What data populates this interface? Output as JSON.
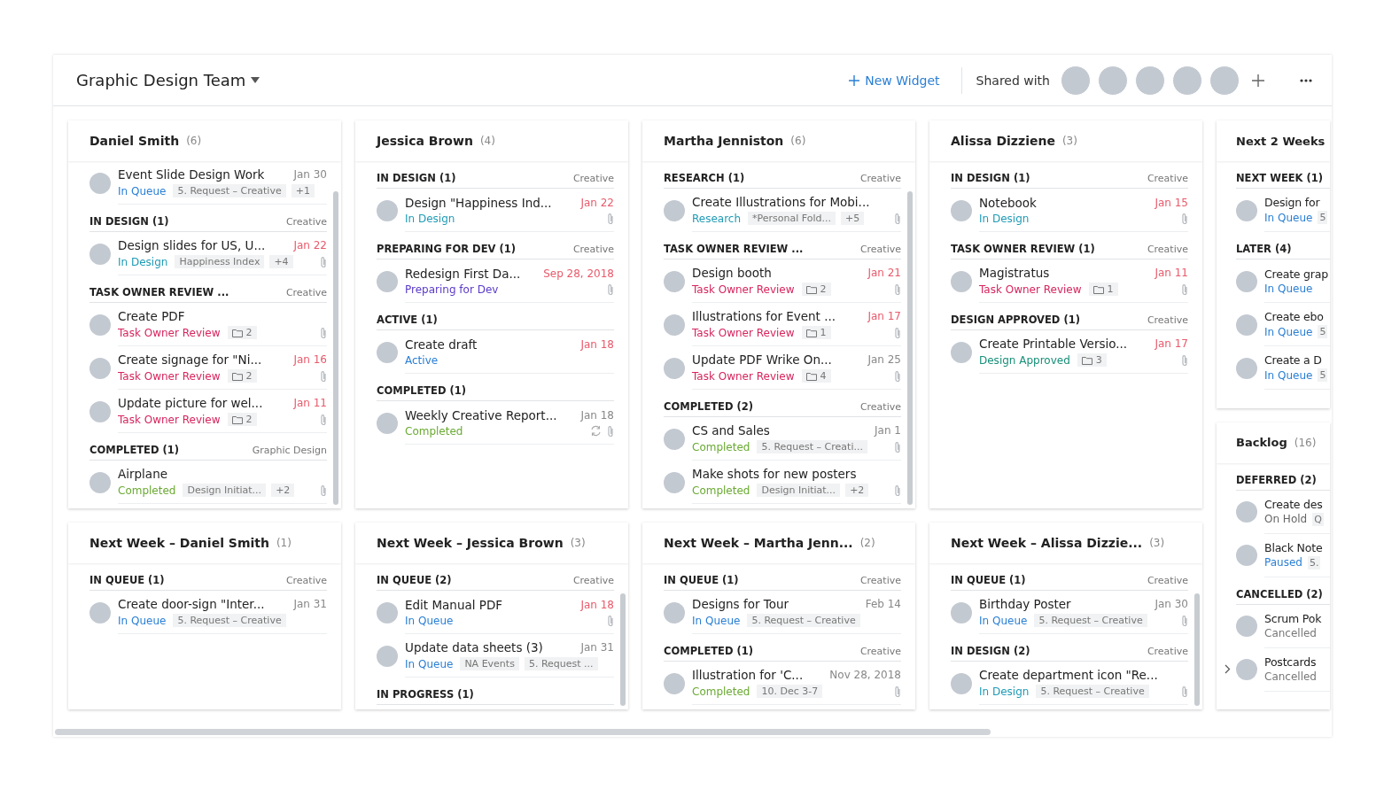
{
  "header": {
    "title": "Graphic Design Team",
    "new_widget": "New Widget",
    "shared_label": "Shared with"
  },
  "columns": [
    {
      "widgets": [
        {
          "title": "Daniel Smith",
          "count": "(6)",
          "scrollbar": true,
          "groups": [
            {
              "tasks": [
                {
                  "title": "Event Slide Design Work",
                  "date": "Jan 30",
                  "overdue": false,
                  "status": "In Queue",
                  "color": "#2a7fd4",
                  "tags": [
                    {
                      "kind": "label",
                      "text": "5. Request – Creative"
                    },
                    {
                      "kind": "label",
                      "text": "+1"
                    }
                  ],
                  "attachment": false
                }
              ]
            },
            {
              "name": "IN DESIGN (1)",
              "category": "Creative",
              "tasks": [
                {
                  "title": "Design slides for US, U...",
                  "date": "Jan 22",
                  "overdue": true,
                  "status": "In Design",
                  "color": "#1f9bb5",
                  "tags": [
                    {
                      "kind": "label",
                      "text": "Happiness Index"
                    },
                    {
                      "kind": "label",
                      "text": "+4"
                    }
                  ],
                  "attachment": true
                }
              ]
            },
            {
              "name": "TASK OWNER REVIEW ...",
              "category": "Creative",
              "tasks": [
                {
                  "title": "Create PDF",
                  "status": "Task Owner Review",
                  "color": "#d6245d",
                  "tags": [
                    {
                      "kind": "folder",
                      "text": "2"
                    }
                  ],
                  "attachment": true
                },
                {
                  "title": "Create signage for \"Ni...",
                  "date": "Jan 16",
                  "overdue": true,
                  "status": "Task Owner Review",
                  "color": "#d6245d",
                  "tags": [
                    {
                      "kind": "folder",
                      "text": "2"
                    }
                  ],
                  "attachment": true
                },
                {
                  "title": "Update picture for wel...",
                  "date": "Jan 11",
                  "overdue": true,
                  "status": "Task Owner Review",
                  "color": "#d6245d",
                  "tags": [
                    {
                      "kind": "folder",
                      "text": "2"
                    }
                  ],
                  "attachment": true
                }
              ]
            },
            {
              "name": "COMPLETED (1)",
              "category": "Graphic Design",
              "tasks": [
                {
                  "title": "Airplane",
                  "status": "Completed",
                  "color": "#6aaa32",
                  "tags": [
                    {
                      "kind": "label",
                      "text": "Design Initiat..."
                    },
                    {
                      "kind": "label",
                      "text": "+2"
                    }
                  ],
                  "attachment": true
                }
              ]
            }
          ]
        },
        {
          "title": "Next Week – Daniel Smith",
          "count": "(1)",
          "scrollbar": false,
          "groups": [
            {
              "name": "IN QUEUE (1)",
              "category": "Creative",
              "tasks": [
                {
                  "title": "Create door-sign \"Inter...",
                  "date": "Jan 31",
                  "overdue": false,
                  "status": "In Queue",
                  "color": "#2a7fd4",
                  "tags": [
                    {
                      "kind": "label",
                      "text": "5. Request – Creative"
                    }
                  ],
                  "attachment": false
                }
              ]
            }
          ]
        }
      ]
    },
    {
      "widgets": [
        {
          "title": "Jessica Brown",
          "count": "(4)",
          "scrollbar": false,
          "groups": [
            {
              "name": "IN DESIGN (1)",
              "category": "Creative",
              "tasks": [
                {
                  "title": "Design \"Happiness Ind...",
                  "date": "Jan 22",
                  "overdue": true,
                  "status": "In Design",
                  "color": "#1f9bb5",
                  "attachment": true
                }
              ]
            },
            {
              "name": "PREPARING FOR DEV (1)",
              "category": "Creative",
              "tasks": [
                {
                  "title": "Redesign First Da...",
                  "date": "Sep 28, 2018",
                  "overdue": true,
                  "status": "Preparing for Dev",
                  "color": "#5a3ac8",
                  "attachment": true
                }
              ]
            },
            {
              "name": "ACTIVE (1)",
              "tasks": [
                {
                  "title": "Create draft",
                  "date": "Jan 18",
                  "overdue": true,
                  "status": "Active",
                  "color": "#2a7fd4",
                  "attachment": false
                }
              ]
            },
            {
              "name": "COMPLETED (1)",
              "tasks": [
                {
                  "title": "Weekly Creative Report...",
                  "date": "Jan 18",
                  "overdue": false,
                  "status": "Completed",
                  "color": "#6aaa32",
                  "attachment": true,
                  "recurring": true
                }
              ]
            }
          ]
        },
        {
          "title": "Next Week – Jessica Brown",
          "count": "(3)",
          "scrollbar": true,
          "groups": [
            {
              "name": "IN QUEUE (2)",
              "category": "Creative",
              "tasks": [
                {
                  "title": "Edit Manual PDF",
                  "date": "Jan 18",
                  "overdue": true,
                  "status": "In Queue",
                  "color": "#2a7fd4",
                  "attachment": true
                },
                {
                  "title": "Update data sheets (3)",
                  "date": "Jan 31",
                  "overdue": false,
                  "status": "In Queue",
                  "color": "#2a7fd4",
                  "tags": [
                    {
                      "kind": "label",
                      "text": "NA Events"
                    },
                    {
                      "kind": "label",
                      "text": "5. Request ..."
                    }
                  ],
                  "attachment": false
                }
              ]
            },
            {
              "name": "IN PROGRESS (1)"
            }
          ]
        }
      ]
    },
    {
      "widgets": [
        {
          "title": "Martha Jenniston",
          "count": "(6)",
          "scrollbar": true,
          "groups": [
            {
              "name": "RESEARCH (1)",
              "category": "Creative",
              "tasks": [
                {
                  "title": "Create Illustrations for Mobi...",
                  "status": "Research",
                  "color": "#1f9bb5",
                  "tags": [
                    {
                      "kind": "label",
                      "text": "*Personal Fold..."
                    },
                    {
                      "kind": "label",
                      "text": "+5"
                    }
                  ],
                  "attachment": true
                }
              ]
            },
            {
              "name": "TASK OWNER REVIEW ...",
              "category": "Creative",
              "tasks": [
                {
                  "title": "Design booth",
                  "date": "Jan 21",
                  "overdue": true,
                  "status": "Task Owner Review",
                  "color": "#d6245d",
                  "tags": [
                    {
                      "kind": "folder",
                      "text": "2"
                    }
                  ],
                  "attachment": true
                },
                {
                  "title": "Illustrations for Event ...",
                  "date": "Jan 17",
                  "overdue": true,
                  "status": "Task Owner Review",
                  "color": "#d6245d",
                  "tags": [
                    {
                      "kind": "folder",
                      "text": "1"
                    }
                  ],
                  "attachment": true
                },
                {
                  "title": "Update PDF Wrike On...",
                  "date": "Jan 25",
                  "overdue": false,
                  "status": "Task Owner Review",
                  "color": "#d6245d",
                  "tags": [
                    {
                      "kind": "folder",
                      "text": "4"
                    }
                  ],
                  "attachment": true
                }
              ]
            },
            {
              "name": "COMPLETED (2)",
              "category": "Creative",
              "tasks": [
                {
                  "title": "CS and Sales",
                  "date": "Jan 1",
                  "overdue": false,
                  "status": "Completed",
                  "color": "#6aaa32",
                  "tags": [
                    {
                      "kind": "label",
                      "text": "5. Request – Creati..."
                    }
                  ],
                  "attachment": true
                },
                {
                  "title": "Make shots for new posters",
                  "status": "Completed",
                  "color": "#6aaa32",
                  "tags": [
                    {
                      "kind": "label",
                      "text": "Design Initiat..."
                    },
                    {
                      "kind": "label",
                      "text": "+2"
                    }
                  ],
                  "attachment": true
                }
              ]
            }
          ]
        },
        {
          "title": "Next Week – Martha Jenn...",
          "count": "(2)",
          "scrollbar": false,
          "groups": [
            {
              "name": "IN QUEUE (1)",
              "category": "Creative",
              "tasks": [
                {
                  "title": "Designs for Tour",
                  "date": "Feb 14",
                  "overdue": false,
                  "status": "In Queue",
                  "color": "#2a7fd4",
                  "tags": [
                    {
                      "kind": "label",
                      "text": "5. Request – Creative"
                    }
                  ],
                  "attachment": false
                }
              ]
            },
            {
              "name": "COMPLETED (1)",
              "category": "Creative",
              "tasks": [
                {
                  "title": "Illustration for 'C...",
                  "date": "Nov 28, 2018",
                  "overdue": false,
                  "status": "Completed",
                  "color": "#6aaa32",
                  "tags": [
                    {
                      "kind": "label",
                      "text": "10. Dec 3-7"
                    }
                  ],
                  "attachment": true
                }
              ]
            }
          ]
        }
      ]
    },
    {
      "widgets": [
        {
          "title": "Alissa Dizziene",
          "count": "(3)",
          "scrollbar": false,
          "groups": [
            {
              "name": "IN DESIGN (1)",
              "category": "Creative",
              "tasks": [
                {
                  "title": "Notebook",
                  "date": "Jan 15",
                  "overdue": true,
                  "status": "In Design",
                  "color": "#1f9bb5",
                  "attachment": true
                }
              ]
            },
            {
              "name": "TASK OWNER REVIEW (1)",
              "category": "Creative",
              "tasks": [
                {
                  "title": "Magistratus",
                  "date": "Jan 11",
                  "overdue": true,
                  "status": "Task Owner Review",
                  "color": "#d6245d",
                  "tags": [
                    {
                      "kind": "folder",
                      "text": "1"
                    }
                  ],
                  "attachment": true
                }
              ]
            },
            {
              "name": "DESIGN APPROVED (1)",
              "category": "Creative",
              "tasks": [
                {
                  "title": "Create Printable Versio...",
                  "date": "Jan 17",
                  "overdue": true,
                  "status": "Design Approved",
                  "color": "#178f79",
                  "tags": [
                    {
                      "kind": "folder",
                      "text": "3"
                    }
                  ],
                  "attachment": true
                }
              ]
            }
          ]
        },
        {
          "title": "Next Week – Alissa Dizzie...",
          "count": "(3)",
          "scrollbar": true,
          "groups": [
            {
              "name": "IN QUEUE (1)",
              "category": "Creative",
              "tasks": [
                {
                  "title": "Birthday Poster",
                  "date": "Jan 30",
                  "overdue": false,
                  "status": "In Queue",
                  "color": "#2a7fd4",
                  "tags": [
                    {
                      "kind": "label",
                      "text": "5. Request – Creative"
                    }
                  ],
                  "attachment": true
                }
              ]
            },
            {
              "name": "IN DESIGN (2)",
              "category": "Creative",
              "tasks": [
                {
                  "title": "Create department icon \"Re...",
                  "status": "In Design",
                  "color": "#1f9bb5",
                  "tags": [
                    {
                      "kind": "label",
                      "text": "5. Request – Creative"
                    }
                  ],
                  "attachment": true
                }
              ]
            }
          ]
        }
      ]
    },
    {
      "widgets": [
        {
          "title": "Next 2 Weeks",
          "scrollbar": false,
          "groups": [
            {
              "name": "NEXT WEEK (1)",
              "tasks": [
                {
                  "title": "Design for",
                  "status": "In Queue",
                  "color": "#2a7fd4",
                  "tags": [
                    {
                      "kind": "label",
                      "text": "5"
                    }
                  ],
                  "attachment": false
                }
              ]
            },
            {
              "name": "LATER (4)",
              "tasks": [
                {
                  "title": "Create grap",
                  "status": "In Queue",
                  "color": "#2a7fd4",
                  "attachment": false
                },
                {
                  "title": "Create ebo",
                  "status": "In Queue",
                  "color": "#2a7fd4",
                  "tags": [
                    {
                      "kind": "label",
                      "text": "5"
                    }
                  ],
                  "attachment": false
                },
                {
                  "title": "Create a D",
                  "status": "In Queue",
                  "color": "#2a7fd4",
                  "tags": [
                    {
                      "kind": "label",
                      "text": "5"
                    }
                  ],
                  "attachment": false
                }
              ]
            }
          ]
        },
        {
          "title": "Backlog",
          "count": "(16)",
          "scrollbar": false,
          "groups": [
            {
              "name": "DEFERRED (2)",
              "tasks": [
                {
                  "title": "Create des",
                  "status": "On Hold",
                  "color": "#666666",
                  "tags": [
                    {
                      "kind": "label",
                      "text": "Q"
                    }
                  ],
                  "attachment": false
                },
                {
                  "title": "Black Note",
                  "status": "Paused",
                  "color": "#2a7fd4",
                  "tags": [
                    {
                      "kind": "label",
                      "text": "5."
                    }
                  ],
                  "attachment": false
                }
              ]
            },
            {
              "name": "CANCELLED (2)",
              "tasks": [
                {
                  "title": "Scrum Pok",
                  "status": "Cancelled",
                  "color": "#777777",
                  "attachment": false
                },
                {
                  "title": "Postcards",
                  "status": "Cancelled",
                  "color": "#777777",
                  "attachment": false,
                  "subtasks": true
                }
              ]
            }
          ]
        }
      ]
    }
  ]
}
